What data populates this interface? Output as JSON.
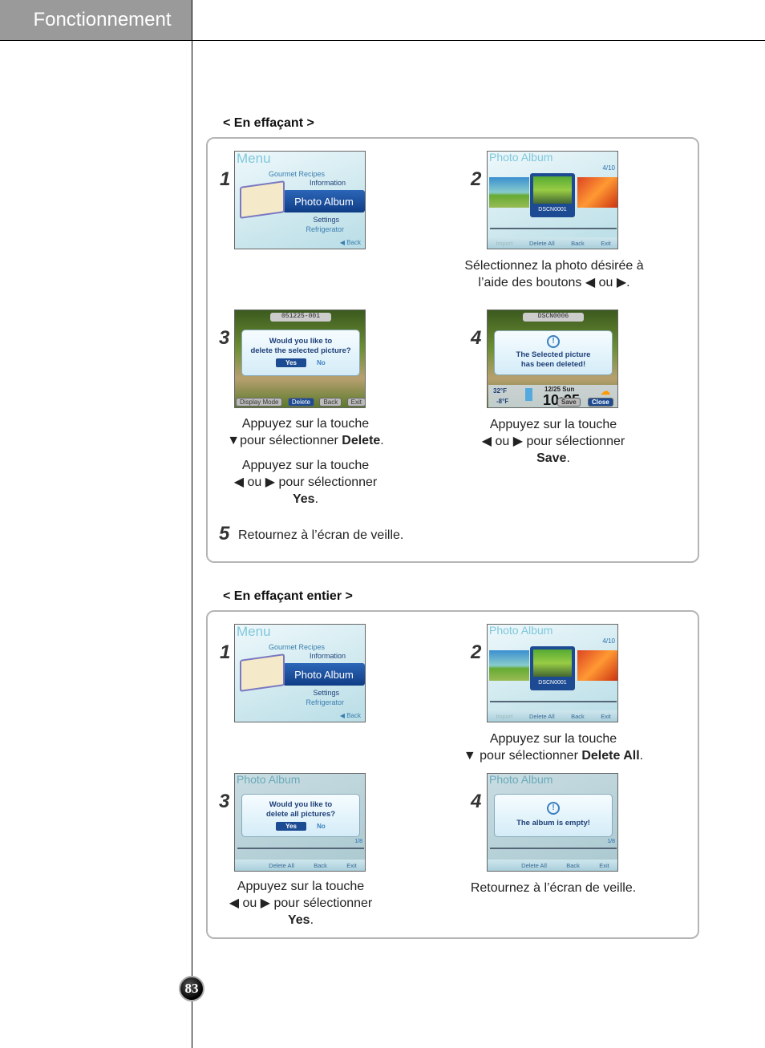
{
  "header": {
    "title": "Fonctionnement"
  },
  "page_number": "83",
  "menu_screen": {
    "title": "Menu",
    "items": [
      "Gourmet Recipes",
      "Information",
      "Photo Album",
      "Settings",
      "Refrigerator"
    ],
    "back": "◀ Back"
  },
  "album_screen": {
    "title": "Photo Album",
    "counter": "4/10",
    "filename": "DSCN0001",
    "buttons": [
      "Import",
      "Delete All",
      "Back",
      "Exit"
    ]
  },
  "section1": {
    "heading": "< En effaçant >",
    "step1": {
      "num": "1"
    },
    "step2": {
      "num": "2",
      "caption": [
        "Sélectionnez la photo désirée à",
        "l’aide des boutons ◀ ou ▶."
      ]
    },
    "step3": {
      "num": "3",
      "screen": {
        "filename": "051225-001",
        "question": [
          "Would you like to",
          "delete the selected picture?"
        ],
        "yes": "Yes",
        "no": "No",
        "buttons": [
          "Display Mode",
          "Delete",
          "Back",
          "Exit"
        ]
      },
      "caption_a": {
        "line1": "Appuyez sur la touche",
        "line2_pre": "▼pour sélectionner ",
        "bold": "Delete",
        "post": "."
      },
      "caption_b": {
        "line1": "Appuyez sur la touche",
        "line2": "◀ ou ▶ pour sélectionner",
        "bold": "Yes",
        "post": "."
      }
    },
    "step4": {
      "num": "4",
      "screen": {
        "filename": "DSCN0006",
        "message": [
          "The Selected picture",
          "has been deleted!"
        ],
        "temp_fridge": "32°F",
        "temp_freezer": "-8°F",
        "date": "12/25 Sun",
        "time": "10:25",
        "save": "Save",
        "close": "Close"
      },
      "caption": {
        "line1": "Appuyez sur la touche",
        "line2": "◀ ou ▶ pour sélectionner",
        "bold": "Save",
        "post": "."
      }
    },
    "step5": {
      "num": "5",
      "text": "Retournez à l’écran de veille."
    }
  },
  "section2": {
    "heading": "< En effaçant entier >",
    "step1": {
      "num": "1"
    },
    "step2": {
      "num": "2",
      "caption": {
        "line1": "Appuyez sur la touche",
        "line2_pre": "▼ pour sélectionner ",
        "bold": "Delete All",
        "post": "."
      }
    },
    "step3": {
      "num": "3",
      "screen": {
        "title": "Photo Album",
        "question": [
          "Would you like to",
          "delete all pictures?"
        ],
        "yes": "Yes",
        "no": "No",
        "counter": "1/8",
        "buttons": [
          "Delete All",
          "Back",
          "Exit"
        ]
      },
      "caption": {
        "line1": "Appuyez sur la touche",
        "line2": "◀ ou ▶ pour sélectionner",
        "bold": "Yes",
        "post": "."
      }
    },
    "step4": {
      "num": "4",
      "screen": {
        "title": "Photo Album",
        "message": "The album is empty!",
        "counter": "1/8",
        "buttons": [
          "Delete All",
          "Back",
          "Exit"
        ]
      },
      "caption": "Retournez à l’écran de veille."
    }
  }
}
